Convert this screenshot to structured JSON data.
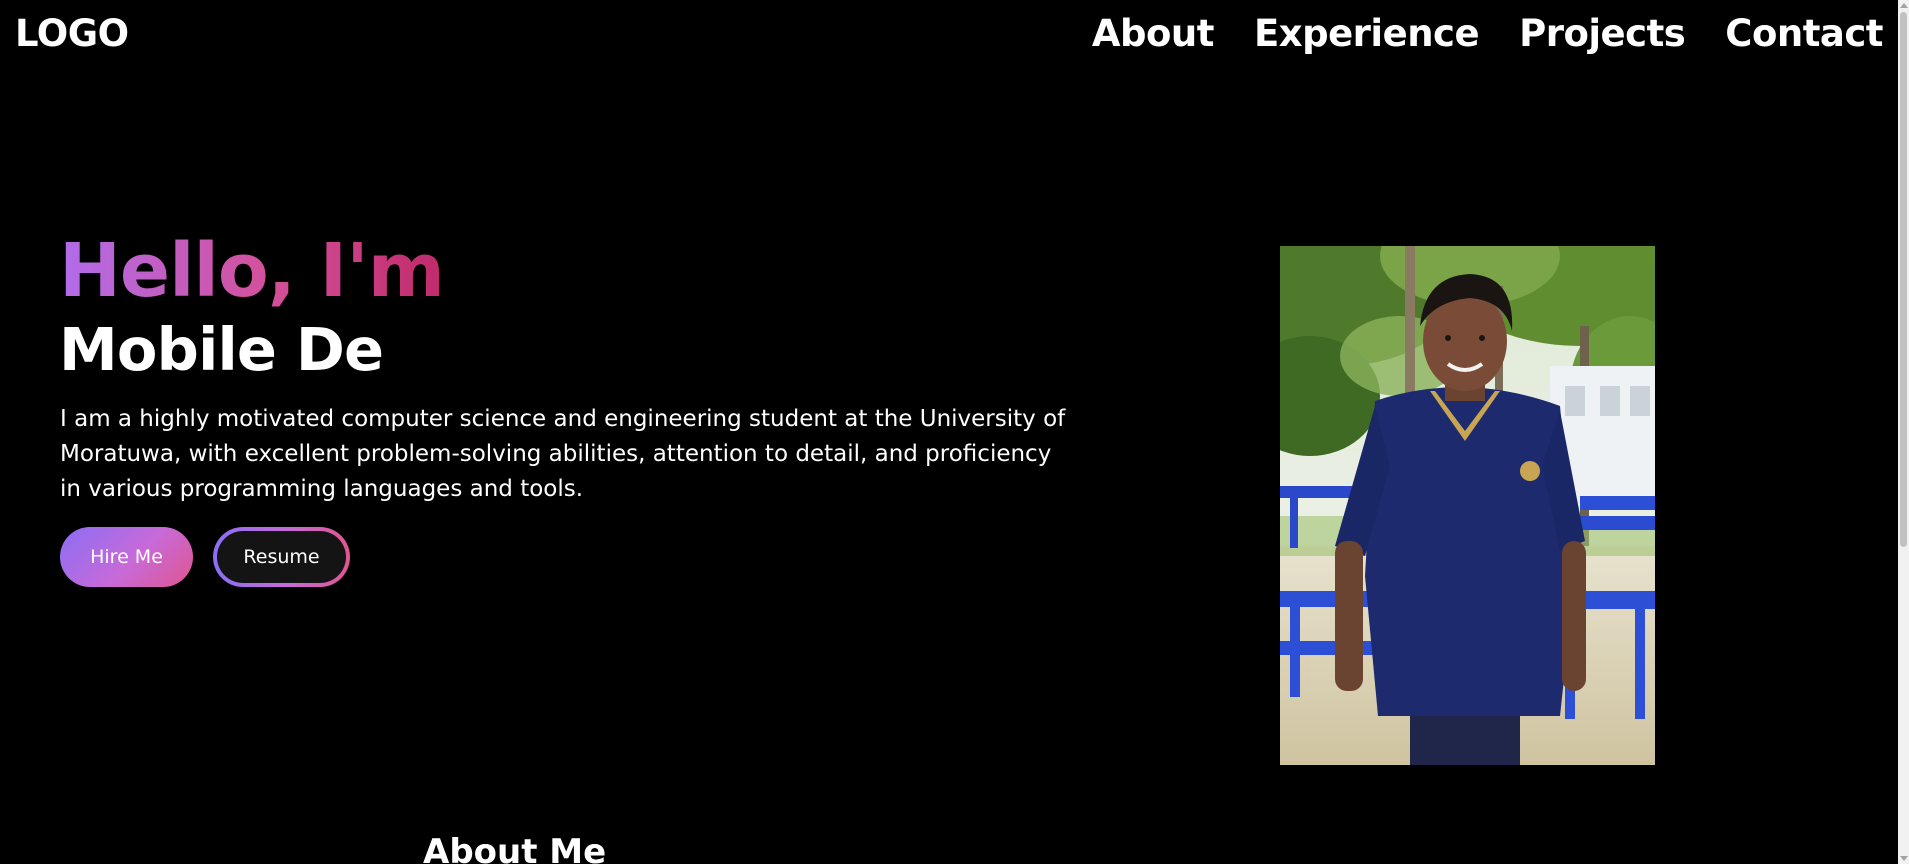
{
  "header": {
    "logo_text": "LOGO",
    "nav": [
      {
        "label": "About"
      },
      {
        "label": "Experience"
      },
      {
        "label": "Projects"
      },
      {
        "label": "Contact"
      }
    ]
  },
  "hero": {
    "greeting": "Hello, I'm",
    "role": "Mobile De",
    "description": "I am a highly motivated computer science and engineering student at the University of Moratuwa, with excellent problem-solving abilities, attention to detail, and proficiency in various programming languages and tools.",
    "buttons": {
      "hire_label": "Hire Me",
      "resume_label": "Resume"
    }
  },
  "about": {
    "title": "About Me"
  },
  "colors": {
    "background": "#000000",
    "text": "#ffffff",
    "gradient_start": "#8b6ef5",
    "gradient_mid": "#c76ad8",
    "gradient_end": "#e0558f"
  },
  "icons": {
    "profile_photo": "profile-photo"
  }
}
